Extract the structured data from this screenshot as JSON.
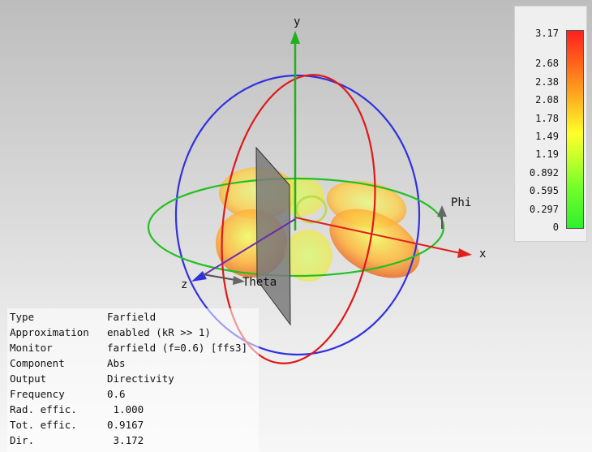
{
  "axes": {
    "x": "x",
    "y": "y",
    "z": "z",
    "phi": "Phi",
    "theta": "Theta"
  },
  "legend": {
    "ticks": [
      "3.17",
      "2.68",
      "2.38",
      "2.08",
      "1.78",
      "1.49",
      "1.19",
      "0.892",
      "0.595",
      "0.297",
      "0"
    ],
    "max": 3.17,
    "colors": {
      "high": "#ff2020",
      "mid": "#ffff2a",
      "low": "#2ef02c"
    }
  },
  "info": [
    {
      "key": "Type",
      "value": "Farfield"
    },
    {
      "key": "Approximation",
      "value": "enabled (kR >> 1)"
    },
    {
      "key": "Monitor",
      "value": "farfield (f=0.6) [ffs3]"
    },
    {
      "key": "Component",
      "value": "Abs"
    },
    {
      "key": "Output",
      "value": "Directivity"
    },
    {
      "key": "Frequency",
      "value": "0.6"
    },
    {
      "key": "Rad. effic.",
      "value": " 1.000"
    },
    {
      "key": "Tot. effic.",
      "value": "0.9167"
    },
    {
      "key": "Dir.",
      "value": " 3.172"
    }
  ]
}
